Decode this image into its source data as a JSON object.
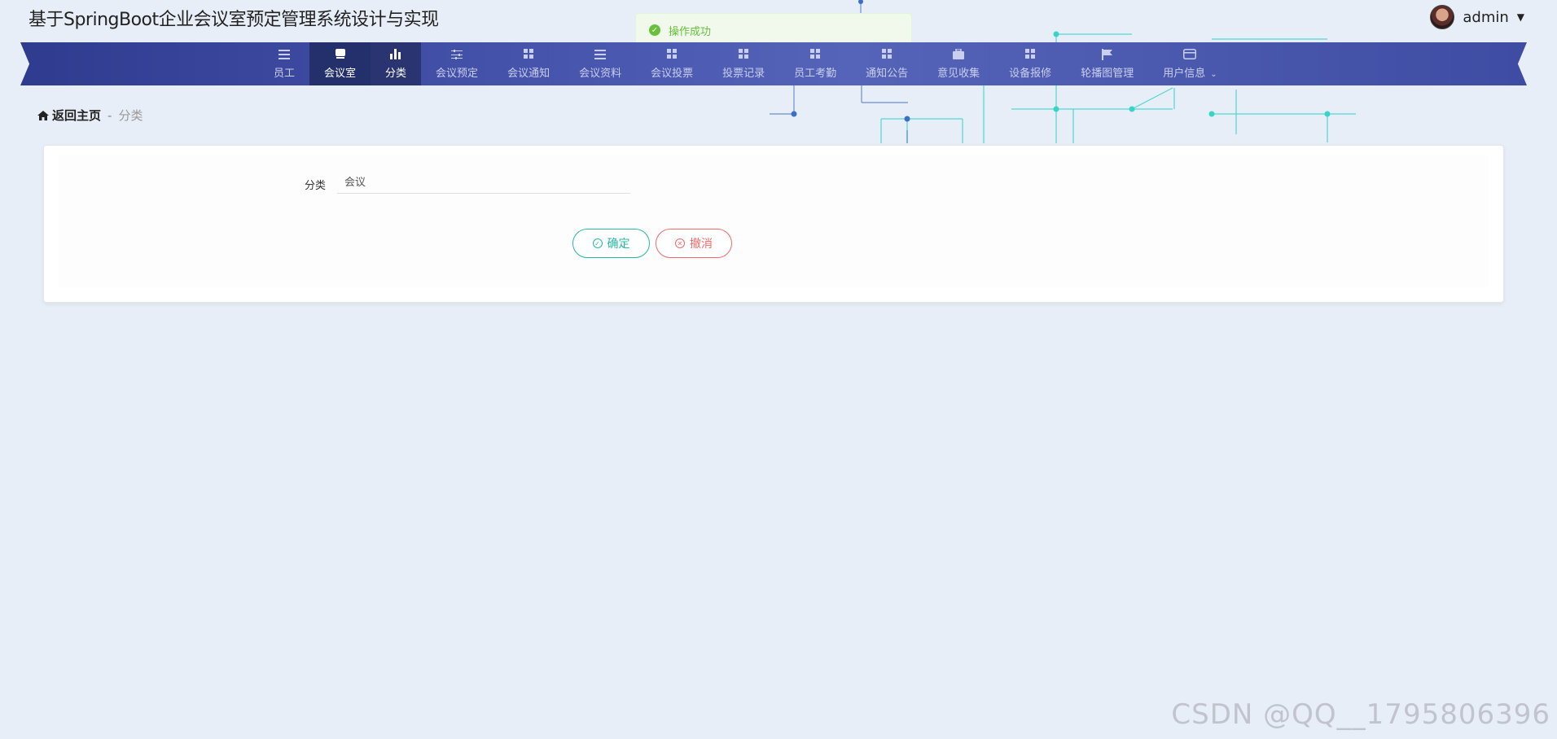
{
  "app": {
    "title": "基于SpringBoot企业会议室预定管理系统设计与实现"
  },
  "user": {
    "name": "admin"
  },
  "toast": {
    "message": "操作成功"
  },
  "nav": {
    "items": [
      {
        "label": "员工",
        "icon": "list-icon"
      },
      {
        "label": "会议室",
        "icon": "monitor-icon"
      },
      {
        "label": "分类",
        "icon": "bar-chart-icon"
      },
      {
        "label": "会议预定",
        "icon": "sliders-icon"
      },
      {
        "label": "会议通知",
        "icon": "grid-icon"
      },
      {
        "label": "会议资料",
        "icon": "list-icon"
      },
      {
        "label": "会议投票",
        "icon": "grid-icon"
      },
      {
        "label": "投票记录",
        "icon": "grid-icon"
      },
      {
        "label": "员工考勤",
        "icon": "grid-icon"
      },
      {
        "label": "通知公告",
        "icon": "grid-icon"
      },
      {
        "label": "意见收集",
        "icon": "briefcase-icon"
      },
      {
        "label": "设备报修",
        "icon": "grid-icon"
      },
      {
        "label": "轮播图管理",
        "icon": "flag-icon"
      },
      {
        "label": "用户信息",
        "icon": "card-icon"
      }
    ]
  },
  "breadcrumb": {
    "home": "返回主页",
    "separator": "-",
    "current": "分类"
  },
  "form": {
    "field_label": "分类",
    "field_value": "会议",
    "confirm_label": "确定",
    "cancel_label": "撤消"
  },
  "watermark": "CSDN @QQ__1795806396",
  "colors": {
    "nav_bg": "#3f4ca3",
    "nav_active": "#2a3470",
    "confirm": "#26b9a2",
    "cancel": "#ef6a6a",
    "toast": "#67c23a"
  }
}
